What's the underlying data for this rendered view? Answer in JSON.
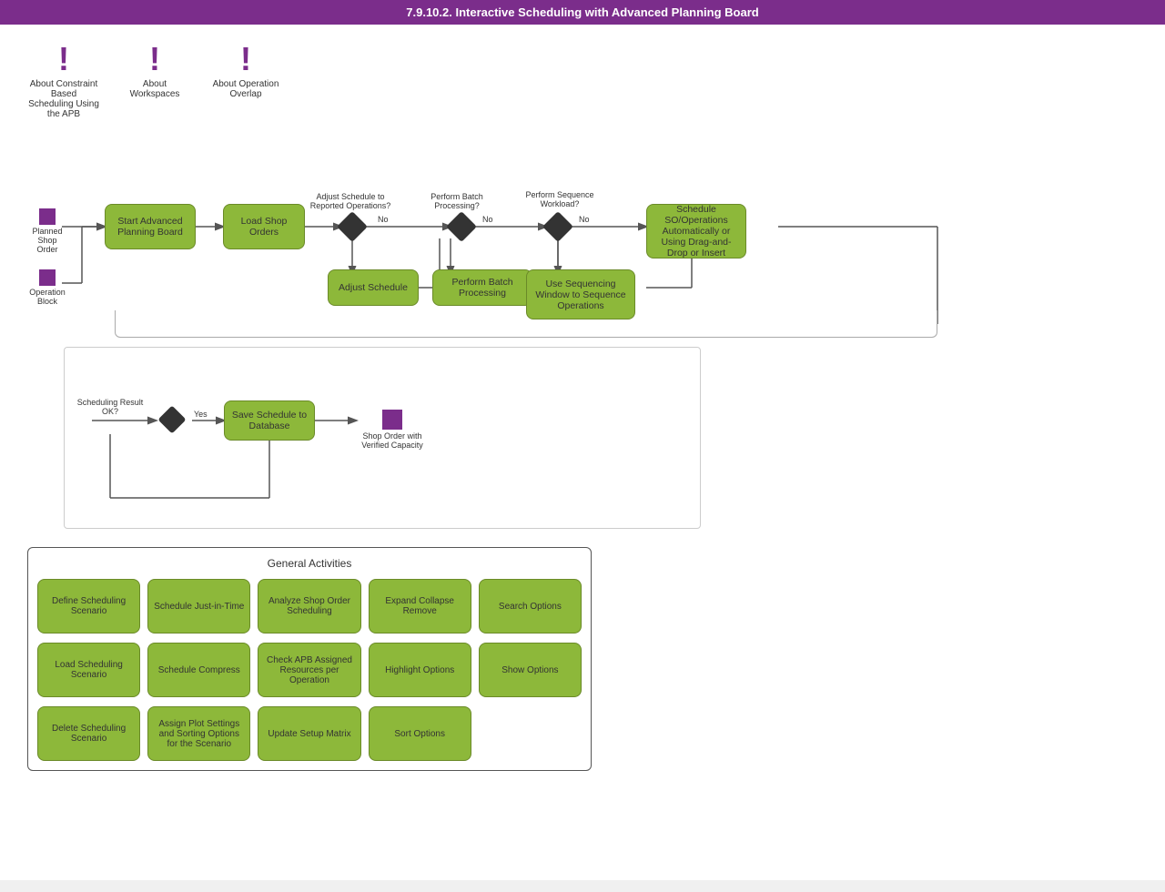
{
  "title": "7.9.10.2. Interactive Scheduling with Advanced Planning Board",
  "icons": [
    {
      "id": "constraint",
      "label": "About Constraint Based Scheduling Using the APB"
    },
    {
      "id": "workspaces",
      "label": "About Workspaces"
    },
    {
      "id": "overlap",
      "label": "About Operation Overlap"
    }
  ],
  "flowchart": {
    "nodes": [
      {
        "id": "planned-shop-order",
        "label": "Planned Shop Order",
        "type": "purple-square-label"
      },
      {
        "id": "operation-block",
        "label": "Operation Block",
        "type": "purple-square-label"
      },
      {
        "id": "start-apb",
        "label": "Start Advanced Planning Board",
        "type": "green-box"
      },
      {
        "id": "load-shop-orders",
        "label": "Load Shop Orders",
        "type": "green-box"
      },
      {
        "id": "adjust-schedule",
        "label": "Adjust Schedule",
        "type": "green-box"
      },
      {
        "id": "perform-batch",
        "label": "Perform Batch Processing",
        "type": "green-box"
      },
      {
        "id": "use-sequencing",
        "label": "Use Sequencing Window to Sequence Operations",
        "type": "green-box"
      },
      {
        "id": "schedule-so",
        "label": "Schedule SO/Operations Automatically or Using Drag-and-Drop or Insert",
        "type": "green-box"
      },
      {
        "id": "save-schedule",
        "label": "Save Schedule to Database",
        "type": "green-box"
      }
    ],
    "decisions": [
      {
        "id": "adjust-q",
        "label": "Adjust Schedule to Reported Operations?"
      },
      {
        "id": "batch-q",
        "label": "Perform Batch Processing?"
      },
      {
        "id": "sequence-q",
        "label": "Perform Sequence Workload?"
      },
      {
        "id": "result-ok-q",
        "label": "Scheduling Result OK?"
      }
    ],
    "no_labels": [
      "No",
      "No",
      "No"
    ],
    "yes_label": "Yes"
  },
  "lower_flow": {
    "shop_order_label": "Shop Order with Verified Capacity"
  },
  "activities": {
    "title": "General Activities",
    "buttons": [
      "Define Scheduling Scenario",
      "Schedule Just-in-Time",
      "Analyze Shop Order Scheduling",
      "Expand Collapse Remove",
      "Search Options",
      "Load Scheduling Scenario",
      "Schedule Compress",
      "Check APB Assigned Resources per Operation",
      "Highlight Options",
      "Show Options",
      "Delete Scheduling Scenario",
      "Assign Plot Settings and Sorting Options for the Scenario",
      "Update Setup Matrix",
      "Sort Options"
    ]
  }
}
